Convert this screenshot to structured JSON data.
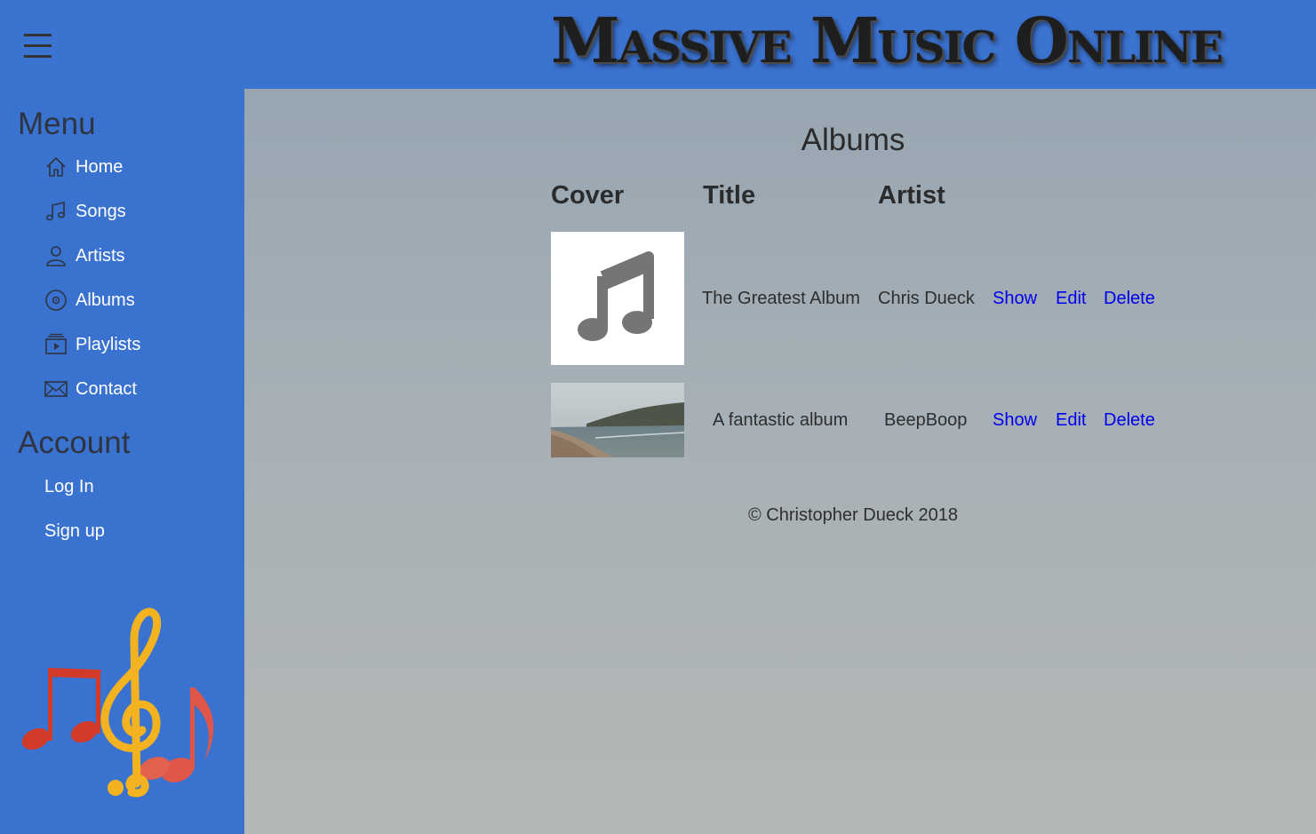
{
  "site": {
    "title": "Massive Music Online"
  },
  "sidebar": {
    "menu_heading": "Menu",
    "items": [
      {
        "label": "Home",
        "icon": "home-icon"
      },
      {
        "label": "Songs",
        "icon": "music-note-icon"
      },
      {
        "label": "Artists",
        "icon": "user-icon"
      },
      {
        "label": "Albums",
        "icon": "disc-icon"
      },
      {
        "label": "Playlists",
        "icon": "playlist-icon"
      },
      {
        "label": "Contact",
        "icon": "envelope-icon"
      }
    ],
    "account_heading": "Account",
    "account_items": [
      {
        "label": "Log In"
      },
      {
        "label": "Sign up"
      }
    ]
  },
  "main": {
    "title": "Albums",
    "columns": [
      "Cover",
      "Title",
      "Artist"
    ],
    "rows": [
      {
        "title": "The Greatest Album",
        "artist": "Chris Dueck",
        "cover": "music-note-placeholder",
        "actions": [
          "Show",
          "Edit",
          "Delete"
        ]
      },
      {
        "title": "A fantastic album",
        "artist": "BeepBoop",
        "cover": "beach-photo",
        "actions": [
          "Show",
          "Edit",
          "Delete"
        ]
      }
    ],
    "footer": "© Christopher Dueck 2018"
  },
  "colors": {
    "header_bg": "#3b73d1",
    "sidebar_bg": "#3a72d0",
    "link": "#0000ee"
  }
}
